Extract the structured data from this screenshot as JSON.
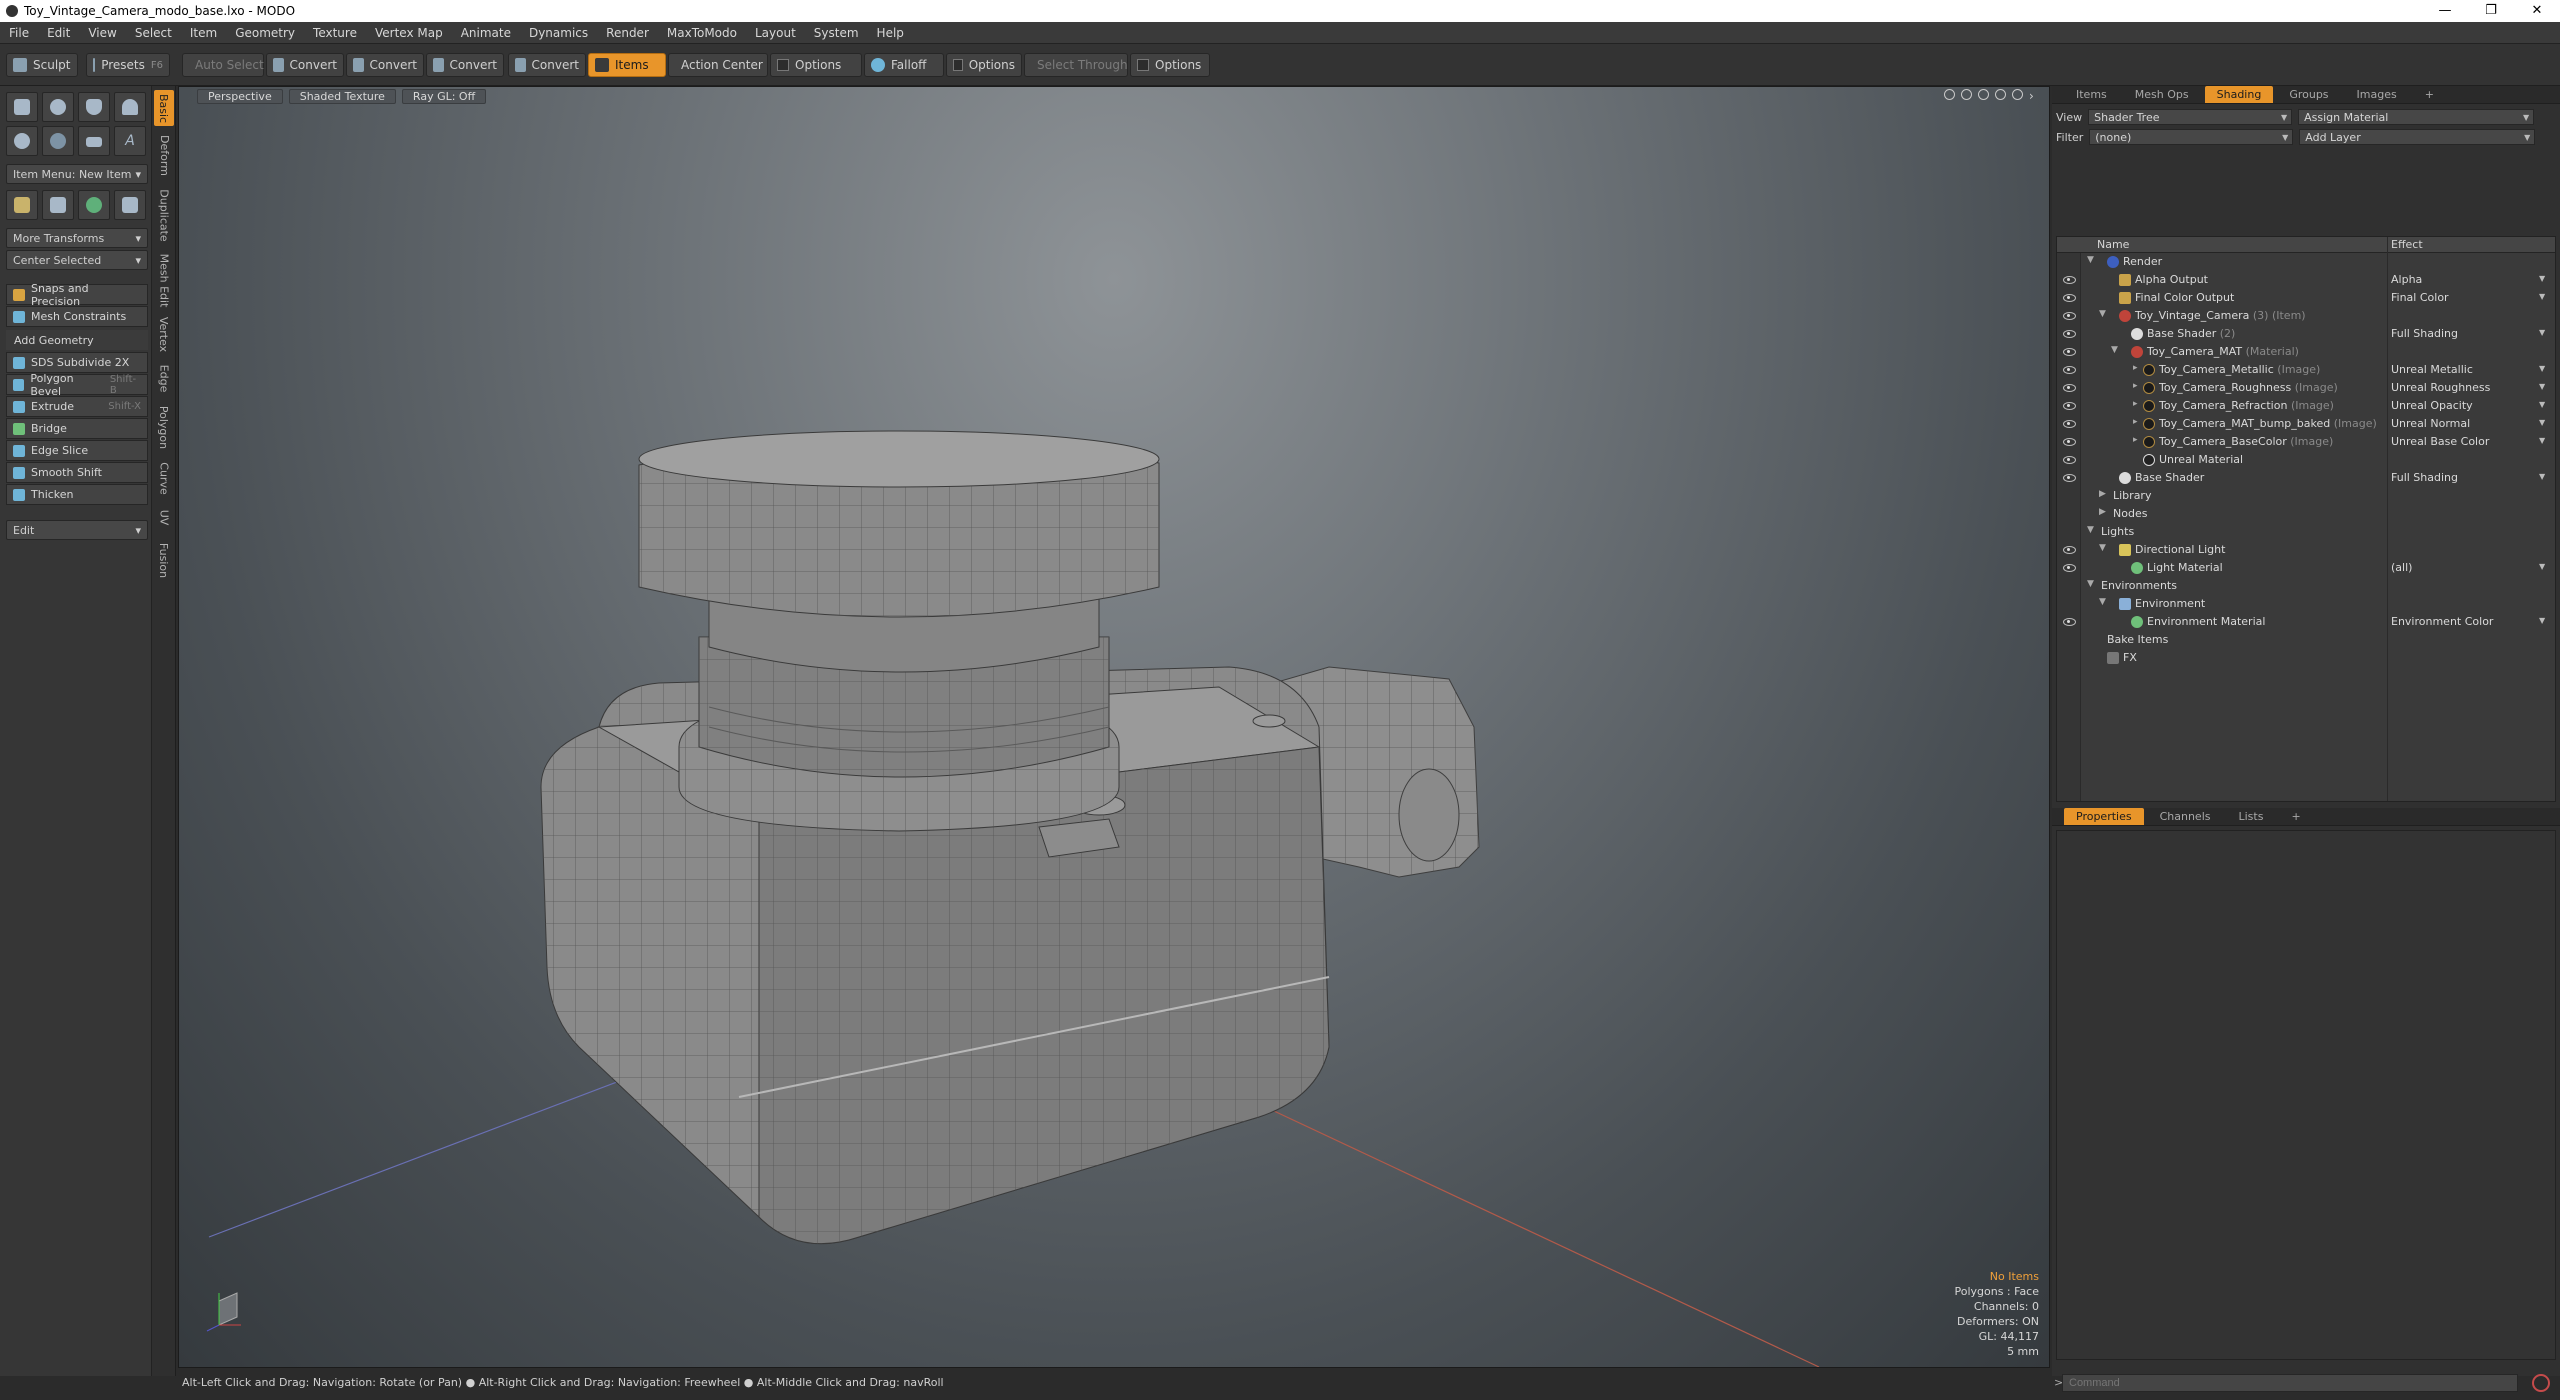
{
  "window": {
    "title": "Toy_Vintage_Camera_modo_base.lxo - MODO",
    "minimize": "—",
    "maximize": "❐",
    "close": "✕"
  },
  "menu": [
    "File",
    "Edit",
    "View",
    "Select",
    "Item",
    "Geometry",
    "Texture",
    "Vertex Map",
    "Animate",
    "Dynamics",
    "Render",
    "MaxToModo",
    "Layout",
    "System",
    "Help"
  ],
  "toolbar": {
    "sculpt": "Sculpt",
    "presets": "Presets",
    "auto_select": "Auto Select",
    "convert": "Convert",
    "items": "Items",
    "action_center": "Action Center",
    "options": "Options",
    "falloff": "Falloff",
    "select_through": "Select Through",
    "presets_shortcut": "F6"
  },
  "left": {
    "item_menu": "Item Menu: New Item",
    "more_transforms": "More Transforms",
    "center_selected": "Center Selected",
    "snaps": "Snaps and Precision",
    "mesh_constraints": "Mesh Constraints",
    "add_geometry": "Add Geometry",
    "tools": [
      {
        "label": "SDS Subdivide 2X",
        "shortcut": ""
      },
      {
        "label": "Polygon Bevel",
        "shortcut": "Shift-B"
      },
      {
        "label": "Extrude",
        "shortcut": "Shift-X"
      },
      {
        "label": "Bridge",
        "shortcut": ""
      },
      {
        "label": "Edge Slice",
        "shortcut": ""
      },
      {
        "label": "Smooth Shift",
        "shortcut": ""
      },
      {
        "label": "Thicken",
        "shortcut": ""
      }
    ],
    "edit": "Edit",
    "vtabs": [
      "Basic",
      "Deform",
      "Duplicate",
      "Mesh Edit",
      "Vertex",
      "Edge",
      "Polygon",
      "Curve",
      "UV",
      "Fusion"
    ]
  },
  "viewport": {
    "perspective": "Perspective",
    "shading": "Shaded Texture",
    "raygl": "Ray GL: Off",
    "info": [
      "No Items",
      "Polygons : Face",
      "Channels: 0",
      "Deformers: ON",
      "GL: 44,117",
      "5 mm"
    ]
  },
  "shading": {
    "tabs": [
      "Items",
      "Mesh Ops",
      "Shading",
      "Groups",
      "Images"
    ],
    "add_tab": "+",
    "view_label": "View",
    "view_value": "Shader Tree",
    "assign": "Assign Material",
    "filter_label": "Filter",
    "filter_value": "(none)",
    "add_layer": "Add Layer",
    "col_name": "Name",
    "col_effect": "Effect",
    "rows": [
      {
        "label": "Render",
        "sub": "",
        "effect": ""
      },
      {
        "label": "Alpha Output",
        "sub": "",
        "effect": "Alpha"
      },
      {
        "label": "Final Color Output",
        "sub": "",
        "effect": "Final Color"
      },
      {
        "label": "Toy_Vintage_Camera",
        "sub": "(3) (Item)",
        "effect": ""
      },
      {
        "label": "Base Shader",
        "sub": "(2)",
        "effect": "Full Shading"
      },
      {
        "label": "Toy_Camera_MAT",
        "sub": "(Material)",
        "effect": ""
      },
      {
        "label": "Toy_Camera_Metallic",
        "sub": "(Image)",
        "effect": "Unreal Metallic"
      },
      {
        "label": "Toy_Camera_Roughness",
        "sub": "(Image)",
        "effect": "Unreal Roughness"
      },
      {
        "label": "Toy_Camera_Refraction",
        "sub": "(Image)",
        "effect": "Unreal Opacity"
      },
      {
        "label": "Toy_Camera_MAT_bump_baked",
        "sub": "(Image)",
        "effect": "Unreal Normal"
      },
      {
        "label": "Toy_Camera_BaseColor",
        "sub": "(Image)",
        "effect": "Unreal Base Color"
      },
      {
        "label": "Unreal Material",
        "sub": "",
        "effect": ""
      },
      {
        "label": "Base Shader",
        "sub": "",
        "effect": "Full Shading"
      },
      {
        "label": "Library",
        "sub": "",
        "effect": ""
      },
      {
        "label": "Nodes",
        "sub": "",
        "effect": ""
      },
      {
        "label": "Lights",
        "sub": "",
        "effect": ""
      },
      {
        "label": "Directional Light",
        "sub": "",
        "effect": ""
      },
      {
        "label": "Light Material",
        "sub": "",
        "effect": "(all)"
      },
      {
        "label": "Environments",
        "sub": "",
        "effect": ""
      },
      {
        "label": "Environment",
        "sub": "",
        "effect": ""
      },
      {
        "label": "Environment Material",
        "sub": "",
        "effect": "Environment Color"
      },
      {
        "label": "Bake Items",
        "sub": "",
        "effect": ""
      },
      {
        "label": "FX",
        "sub": "",
        "effect": ""
      }
    ]
  },
  "properties": {
    "tabs": [
      "Properties",
      "Channels",
      "Lists"
    ],
    "add_tab": "+"
  },
  "status": "Alt-Left Click and Drag: Navigation: Rotate (or Pan) ● Alt-Right Click and Drag: Navigation: Freewheel ● Alt-Middle Click and Drag: navRoll",
  "command_placeholder": "Command",
  "command_prompt": ">",
  "colors": {
    "accent": "#e8952a",
    "background": "#2b2b2b"
  }
}
